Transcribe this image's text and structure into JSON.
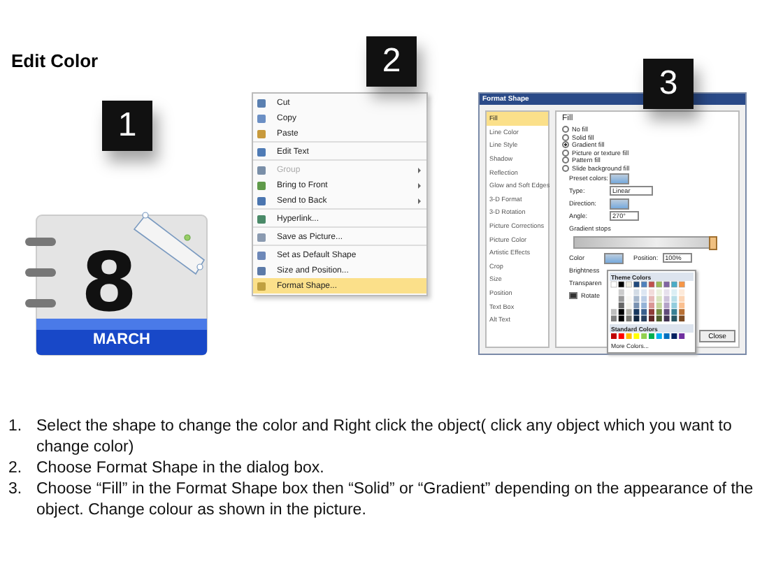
{
  "title": "Edit Color",
  "steps": [
    {
      "number": "1"
    },
    {
      "number": "2"
    },
    {
      "number": "3"
    }
  ],
  "calendar": {
    "day": "8",
    "month": "MARCH"
  },
  "context_menu": {
    "items": [
      {
        "label": "Cut",
        "disabled": false,
        "selected": false,
        "submenu": false,
        "divider_after": false
      },
      {
        "label": "Copy",
        "disabled": false,
        "selected": false,
        "submenu": false,
        "divider_after": false
      },
      {
        "label": "Paste",
        "disabled": false,
        "selected": false,
        "submenu": false,
        "divider_after": true
      },
      {
        "label": "Edit Text",
        "disabled": false,
        "selected": false,
        "submenu": false,
        "divider_after": true
      },
      {
        "label": "Group",
        "disabled": true,
        "selected": false,
        "submenu": true,
        "divider_after": false
      },
      {
        "label": "Bring to Front",
        "disabled": false,
        "selected": false,
        "submenu": true,
        "divider_after": false
      },
      {
        "label": "Send to Back",
        "disabled": false,
        "selected": false,
        "submenu": true,
        "divider_after": true
      },
      {
        "label": "Hyperlink...",
        "disabled": false,
        "selected": false,
        "submenu": false,
        "divider_after": true
      },
      {
        "label": "Save as Picture...",
        "disabled": false,
        "selected": false,
        "submenu": false,
        "divider_after": true
      },
      {
        "label": "Set as Default Shape",
        "disabled": false,
        "selected": false,
        "submenu": false,
        "divider_after": false
      },
      {
        "label": "Size and Position...",
        "disabled": false,
        "selected": false,
        "submenu": false,
        "divider_after": false
      },
      {
        "label": "Format Shape...",
        "disabled": false,
        "selected": true,
        "submenu": false,
        "divider_after": false
      }
    ]
  },
  "dialog": {
    "title": "Format Shape",
    "categories": [
      {
        "label": "Fill",
        "selected": true
      },
      {
        "label": "Line Color",
        "selected": false
      },
      {
        "label": "Line Style",
        "selected": false
      },
      {
        "label": "Shadow",
        "selected": false
      },
      {
        "label": "Reflection",
        "selected": false
      },
      {
        "label": "Glow and Soft Edges",
        "selected": false
      },
      {
        "label": "3-D Format",
        "selected": false
      },
      {
        "label": "3-D Rotation",
        "selected": false
      },
      {
        "label": "Picture Corrections",
        "selected": false
      },
      {
        "label": "Picture Color",
        "selected": false
      },
      {
        "label": "Artistic Effects",
        "selected": false
      },
      {
        "label": "Crop",
        "selected": false
      },
      {
        "label": "Size",
        "selected": false
      },
      {
        "label": "Position",
        "selected": false
      },
      {
        "label": "Text Box",
        "selected": false
      },
      {
        "label": "Alt Text",
        "selected": false
      }
    ],
    "section": "Fill",
    "fill_options": [
      {
        "label": "No fill",
        "selected": false
      },
      {
        "label": "Solid fill",
        "selected": false
      },
      {
        "label": "Gradient fill",
        "selected": true
      },
      {
        "label": "Picture or texture fill",
        "selected": false
      },
      {
        "label": "Pattern fill",
        "selected": false
      },
      {
        "label": "Slide background fill",
        "selected": false
      }
    ],
    "preset_colors_label": "Preset colors:",
    "type_label": "Type:",
    "type_value": "Linear",
    "direction_label": "Direction:",
    "angle_label": "Angle:",
    "angle_value": "270°",
    "gradient_stops_label": "Gradient stops",
    "gradient_stop": {
      "level": 1
    },
    "color_label": "Color",
    "position_label": "Position:",
    "position_value": "100%",
    "brightness_label": "Brightness",
    "transparency_label": "Transparen",
    "rotate": {
      "label": "Rotate",
      "checked": true
    },
    "theme_colors_label": "Theme Colors",
    "standard_colors_label": "Standard Colors",
    "more_colors_label": "More Colors...",
    "close_button": "Close"
  },
  "instructions": [
    {
      "number": "1.",
      "text": "Select the shape to change the color and Right click the object( click any object which you want to change color)"
    },
    {
      "number": "2.",
      "text": "Choose Format Shape in the dialog box."
    },
    {
      "number": "3.",
      "text": "Choose “Fill” in the Format Shape box then “Solid” or “Gradient” depending on the appearance of the object. Change colour as shown in the picture."
    }
  ]
}
